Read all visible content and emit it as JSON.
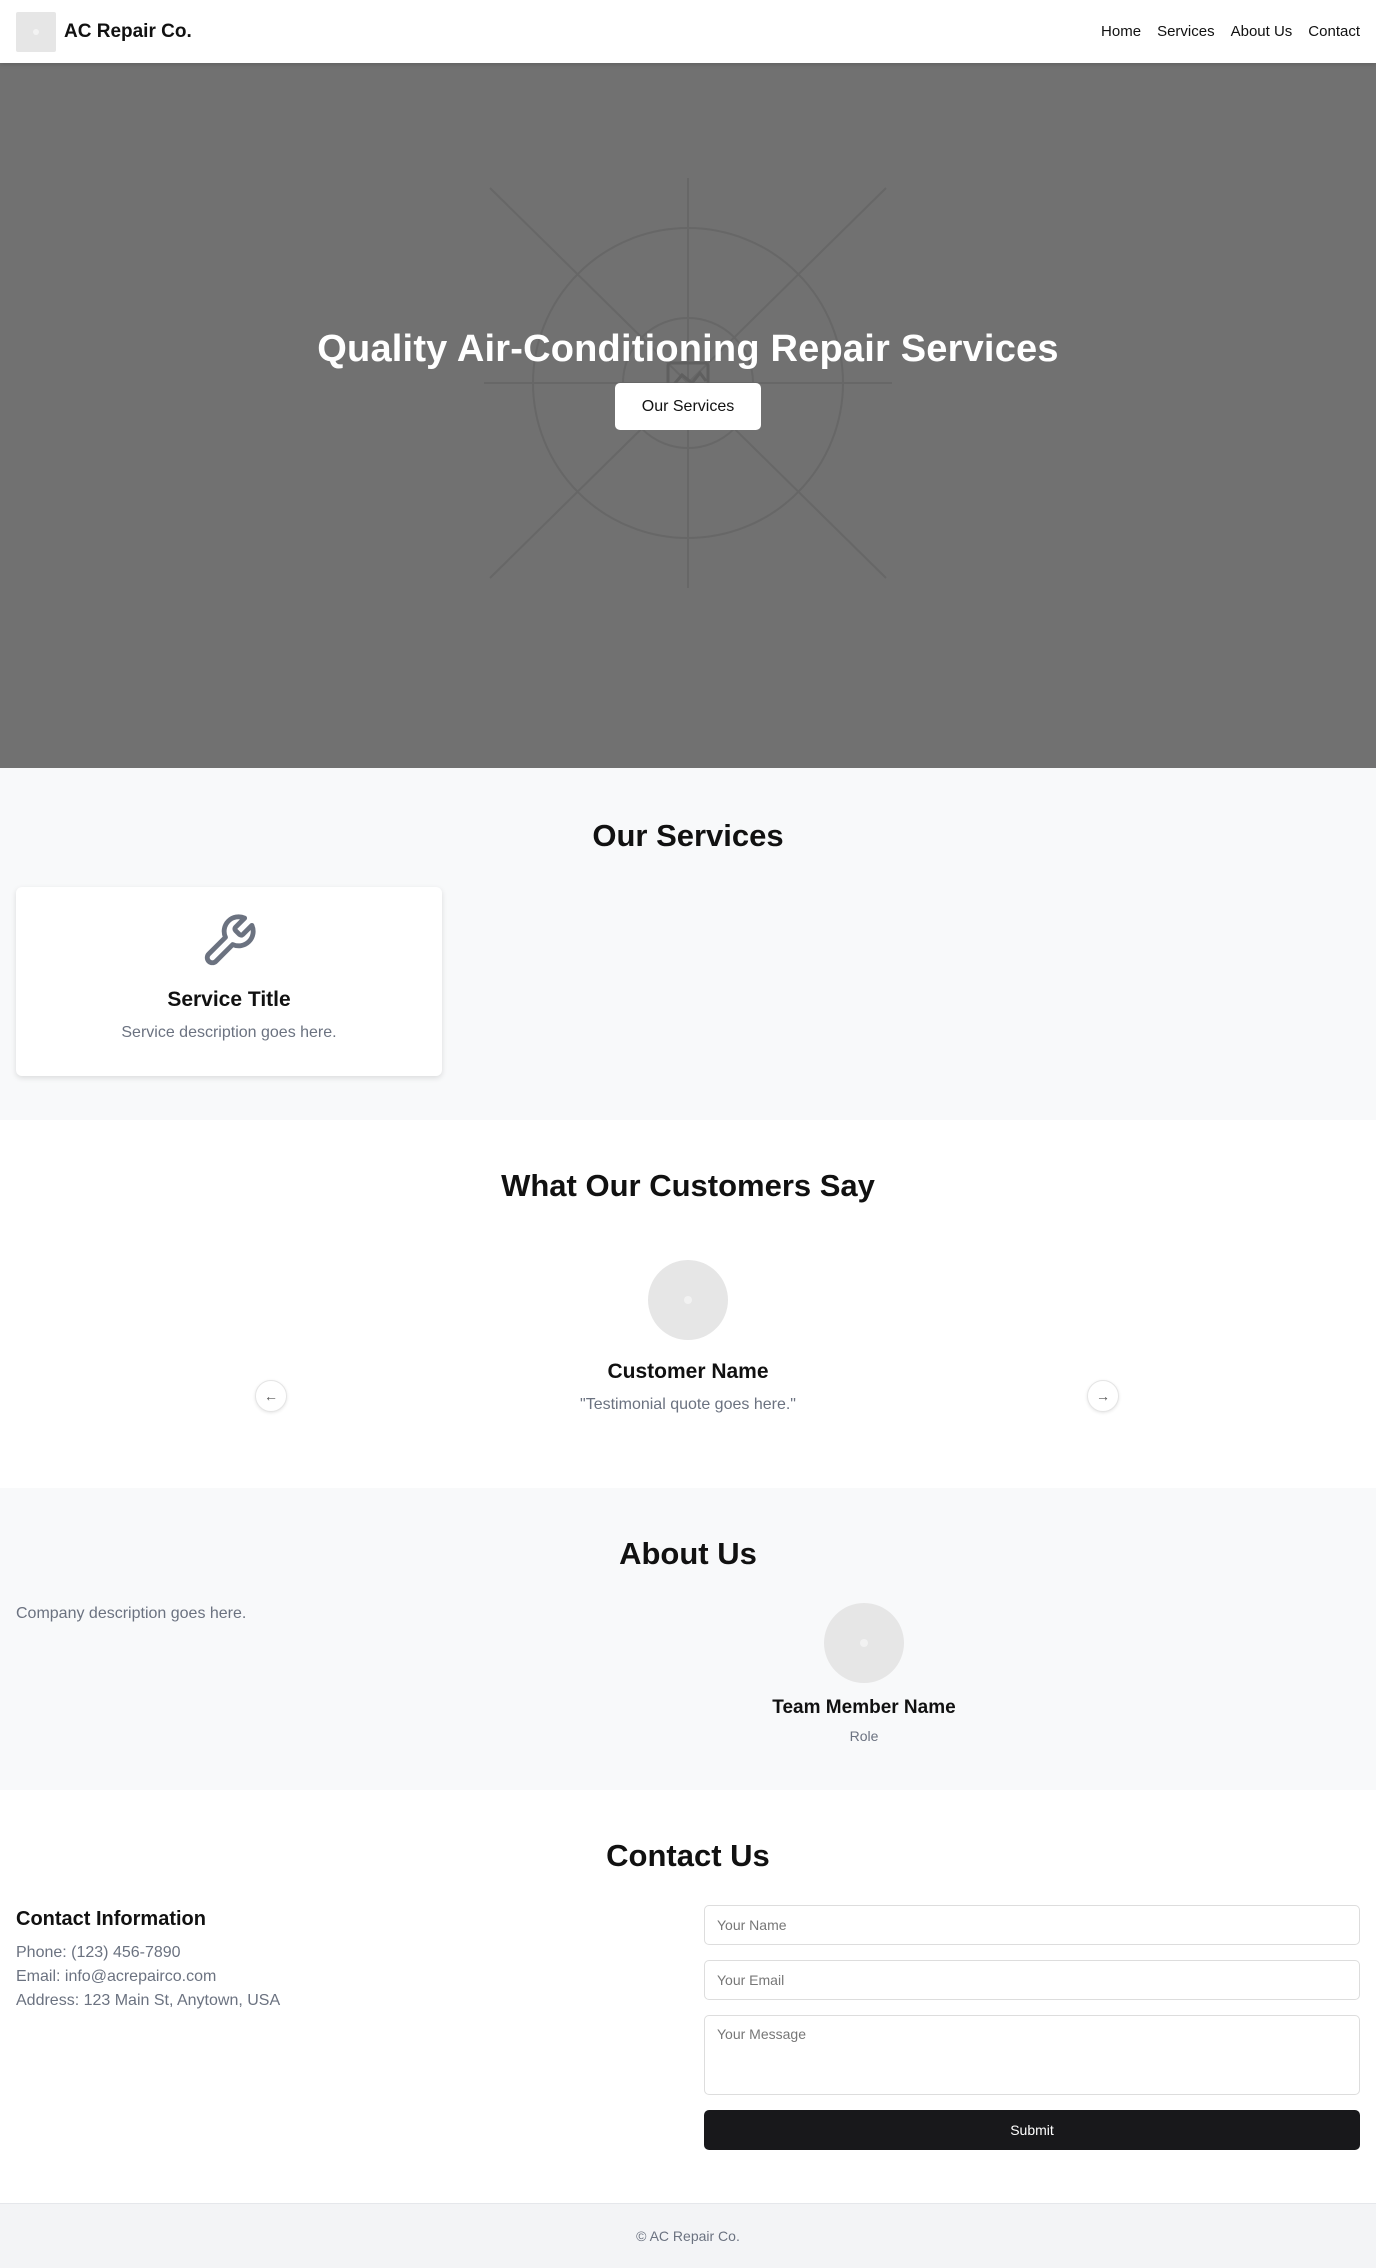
{
  "header": {
    "brand": "AC Repair Co.",
    "nav": [
      "Home",
      "Services",
      "About Us",
      "Contact"
    ]
  },
  "hero": {
    "title": "Quality Air-Conditioning Repair Services",
    "button": "Our Services"
  },
  "services": {
    "title": "Our Services",
    "cards": [
      {
        "icon": "wrench-icon",
        "title": "Service Title",
        "description": "Service description goes here."
      }
    ]
  },
  "testimonials": {
    "title": "What Our Customers Say",
    "items": [
      {
        "name": "Customer Name",
        "quote": "\"Testimonial quote goes here.\""
      }
    ],
    "prev_icon": "arrow-left-icon",
    "next_icon": "arrow-right-icon"
  },
  "about": {
    "title": "About Us",
    "description": "Company description goes here.",
    "team": [
      {
        "name": "Team Member Name",
        "role": "Role"
      }
    ]
  },
  "contact": {
    "title": "Contact Us",
    "info_heading": "Contact Information",
    "phone": "Phone: (123) 456-7890",
    "email": "Email: info@acrepairco.com",
    "address": "Address: 123 Main St, Anytown, USA",
    "name_placeholder": "Your Name",
    "email_placeholder": "Your Email",
    "message_placeholder": "Your Message",
    "submit": "Submit"
  },
  "footer": {
    "copyright": "© AC Repair Co."
  },
  "colors": {
    "hero_bg": "#717171",
    "section_alt_bg": "#f8f9fa",
    "button_dark": "#18181b",
    "muted_text": "#6b7280"
  }
}
